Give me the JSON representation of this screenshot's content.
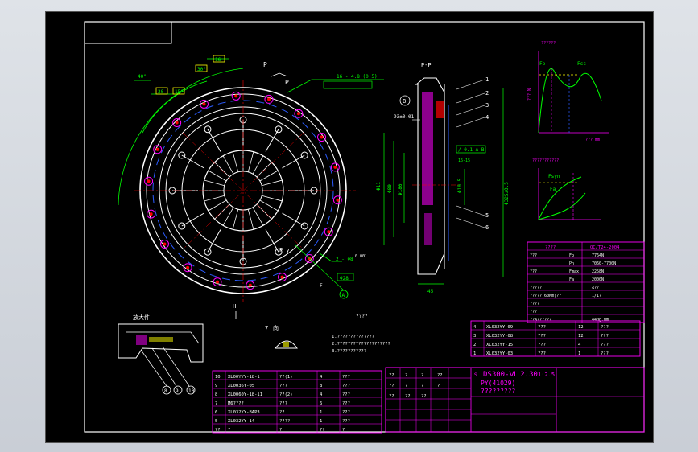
{
  "colors": {
    "background": "#000000",
    "frame": "#ffffff",
    "green": "#00ff00",
    "magenta": "#ff00ff",
    "yellow": "#ffff00",
    "red": "#ff0000",
    "cyan": "#00ffff",
    "blue": "#2b5cff",
    "table_border": "#ff00ff",
    "ground": "#dfe3e8"
  },
  "main_view": {
    "section_letter": "P",
    "section_letter_2": "P",
    "dim_1": "16",
    "dim_2": "30°",
    "dim_3": "40°",
    "dim_4": "20",
    "dim_5": "15°",
    "tol_1": "16 - 4.8 (0.5)",
    "tol_2": "2 - Φ8",
    "tol_3": "0.001",
    "tol_4": "Φ28",
    "circle_a": "A",
    "view_h": "H",
    "py": "P y",
    "f_label": "F"
  },
  "section_view": {
    "title": "P-P",
    "circle_b": "B",
    "dim_left": "93±0.01",
    "dim_d1": "Φ11",
    "dim_d2": "Φ80",
    "dim_d3": "Φ180",
    "dim_d4": "Φ325±0.5",
    "dim_d5": "Φ10.5",
    "dim_bottom": "45",
    "tol_box": "/ 0.1 A B",
    "tol_small": "16-15",
    "callouts": [
      "1",
      "2",
      "3",
      "4",
      "5",
      "6"
    ]
  },
  "detail_view": {
    "label": "放大件",
    "callouts": [
      "8",
      "9",
      "10"
    ]
  },
  "small_view": {
    "label": "7",
    "label2": "向"
  },
  "notes": {
    "title": "????",
    "lines": [
      "1.??????????????",
      "2.????????????????????",
      "3.???????????"
    ]
  },
  "graph1": {
    "title": "??????",
    "ylabel": "??? N",
    "xlabel": "??? mm",
    "labels": [
      "Fp",
      "Fcc"
    ]
  },
  "graph2": {
    "title": "???????????",
    "labels": [
      "Fsyn",
      "Fa"
    ]
  },
  "spec_table": {
    "header_left": "????",
    "header_right": "QC/T24-2004",
    "rows": [
      {
        "left": "???",
        "sym": "Fp",
        "value": "7764N"
      },
      {
        "left": "",
        "sym": "Pn",
        "value": "7060-7700N"
      },
      {
        "left": "???",
        "sym": "Fmax",
        "value": "2258N"
      },
      {
        "left": "",
        "sym": "Fa",
        "value": "2000N"
      },
      {
        "left": "?????",
        "sym": "",
        "value": "≤??"
      },
      {
        "left": "?????(60Nm)??",
        "sym": "",
        "value": "1/1?"
      },
      {
        "left": "????",
        "sym": "",
        "value": ""
      },
      {
        "left": "???",
        "sym": "",
        "value": ""
      },
      {
        "left": "??A??????",
        "sym": "",
        "value": "440g.mm"
      }
    ]
  },
  "bom_upper": [
    {
      "no": "4",
      "code": "XL032YY-09",
      "name": "???",
      "qty": "12",
      "note": "???"
    },
    {
      "no": "3",
      "code": "XL032YY-08",
      "name": "???",
      "qty": "12",
      "note": "???"
    },
    {
      "no": "2",
      "code": "XL032YY-15",
      "name": "???",
      "qty": "4",
      "note": "???"
    },
    {
      "no": "1",
      "code": "XL032YY-03",
      "name": "???",
      "qty": "1",
      "note": "???"
    }
  ],
  "bom_lower": [
    {
      "no": "10",
      "code": "XL00YYY-18-1",
      "name": "??(1)",
      "qty": "4",
      "note": "???"
    },
    {
      "no": "9",
      "code": "XL0036Y-05",
      "name": "???",
      "qty": "8",
      "note": "???"
    },
    {
      "no": "8",
      "code": "XL0060Y-18-11",
      "name": "??(2)",
      "qty": "4",
      "note": "???"
    },
    {
      "no": "7",
      "code": "M6????",
      "name": "???",
      "qty": "6",
      "note": "???"
    },
    {
      "no": "6",
      "code": "XL032YY-BAP3",
      "name": "??",
      "qty": "1",
      "note": "???"
    },
    {
      "no": "5",
      "code": "XL032YY-14",
      "name": "????",
      "qty": "1",
      "note": "???"
    },
    {
      "no": "??",
      "code": "?",
      "name": "?",
      "qty": "??",
      "note": "?"
    }
  ],
  "title_block": {
    "drawing_no": "DS300-Ⅵ 2.30",
    "scale": "1:2.5",
    "part": "PY(41029)",
    "name": "?????????",
    "cells": [
      "??",
      "?",
      "?",
      "??",
      "??",
      "?",
      "?",
      "?",
      "??",
      "??",
      "??"
    ],
    "s_label": "S"
  }
}
